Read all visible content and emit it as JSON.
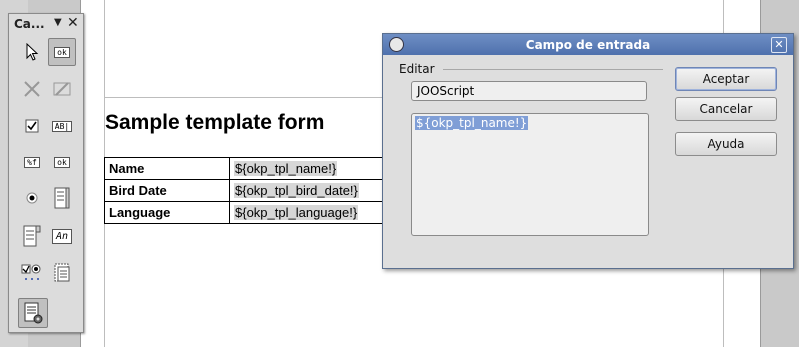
{
  "toolbox": {
    "title": "Ca...",
    "menu_glyph": "▼",
    "close_glyph": "✕",
    "tools": [
      {
        "name": "select-tool",
        "icon": "arrow-pointer-icon"
      },
      {
        "name": "push-button-tool",
        "icon": "ok-button-icon",
        "label": "ok",
        "active": true
      },
      {
        "name": "design-mode-tool",
        "icon": "tools-icon",
        "disabled": true
      },
      {
        "name": "form-design-tool",
        "icon": "form-design-icon",
        "disabled": true
      },
      {
        "name": "check-box-tool",
        "icon": "checkbox-icon"
      },
      {
        "name": "text-box-tool",
        "icon": "textbox-icon",
        "label": "AB|"
      },
      {
        "name": "formatted-field-tool",
        "icon": "formatted-field-icon",
        "label": "%f"
      },
      {
        "name": "push-button-tool-2",
        "icon": "ok-button-icon",
        "label": "ok"
      },
      {
        "name": "option-button-tool",
        "icon": "radio-icon"
      },
      {
        "name": "list-box-tool",
        "icon": "listbox-icon"
      },
      {
        "name": "combo-box-tool",
        "icon": "combobox-icon"
      },
      {
        "name": "label-tool",
        "icon": "label-field-icon",
        "label": "An"
      },
      {
        "name": "more-controls-tool",
        "icon": "more-controls-icon"
      },
      {
        "name": "form-navigator-tool",
        "icon": "form-navigator-icon"
      },
      {
        "name": "form-properties-tool",
        "icon": "form-properties-icon",
        "active": true
      }
    ]
  },
  "document": {
    "title": "Sample template form",
    "rows": [
      {
        "label": "Name",
        "value": "${okp_tpl_name!}"
      },
      {
        "label": "Bird Date",
        "value": "${okp_tpl_bird_date!}"
      },
      {
        "label": "Language",
        "value": "${okp_tpl_language!}"
      }
    ]
  },
  "dialog": {
    "title": "Campo de entrada",
    "close_glyph": "✕",
    "group_label": "Editar",
    "name_value": "JOOScript",
    "content_value": "${okp_tpl_name!}",
    "buttons": {
      "accept": "Aceptar",
      "cancel": "Cancelar",
      "help": "Ayuda"
    }
  }
}
